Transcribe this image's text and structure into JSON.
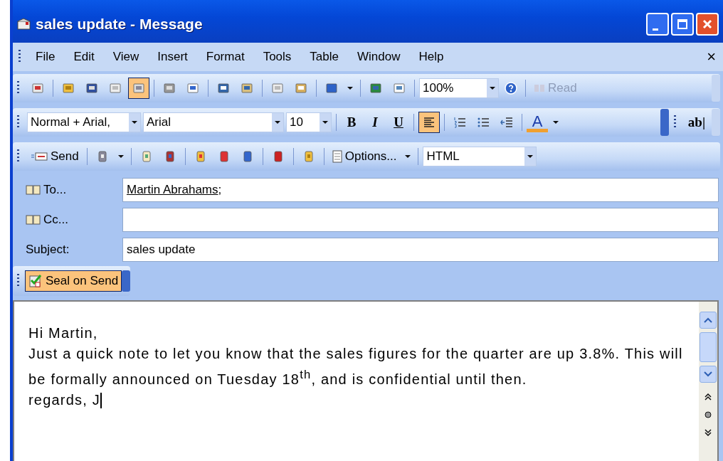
{
  "window": {
    "title": "sales update - Message"
  },
  "menu": [
    {
      "label": "File"
    },
    {
      "label": "Edit"
    },
    {
      "label": "View"
    },
    {
      "label": "Insert"
    },
    {
      "label": "Format"
    },
    {
      "label": "Tools"
    },
    {
      "label": "Table"
    },
    {
      "label": "Window"
    },
    {
      "label": "Help"
    }
  ],
  "menu_close": "×",
  "standard_toolbar": {
    "buttons": [
      {
        "pressed": false
      },
      {
        "pressed": false
      },
      {
        "pressed": false
      },
      {
        "pressed": false
      },
      {
        "pressed": true
      },
      {
        "pressed": false
      },
      {
        "pressed": false
      },
      {
        "pressed": false
      },
      {
        "pressed": false
      },
      {
        "pressed": false
      },
      {
        "pressed": false
      },
      {
        "pressed": false
      },
      {
        "pressed": false
      },
      {
        "pressed": false
      }
    ],
    "zoom": "100%",
    "read": "Read"
  },
  "formatting_toolbar": {
    "style": "Normal + Arial,",
    "font": "Arial",
    "size": "10",
    "bold": "B",
    "italic": "I",
    "underline": "U",
    "align_left_pressed": true,
    "font_color": "A",
    "field_shading": "ab|"
  },
  "envelope_toolbar": {
    "send": "Send",
    "options": "Options...",
    "format": "HTML"
  },
  "header": {
    "to": {
      "label": "To...",
      "recipients": [
        "Martin Abrahams"
      ],
      "separator": ";"
    },
    "cc": {
      "label": "Cc..."
    },
    "subject": {
      "label": "Subject:",
      "value": "sales update"
    }
  },
  "seal_button": {
    "label": "Seal on Send",
    "pressed": true
  },
  "body": [
    "Hi Martin,",
    "Just a quick note to let you know that the sales figures for the quarter are up 3.8%. This will be formally announced on Tuesday 18$^{th}$, and is confidential until then.",
    "regards, J"
  ]
}
